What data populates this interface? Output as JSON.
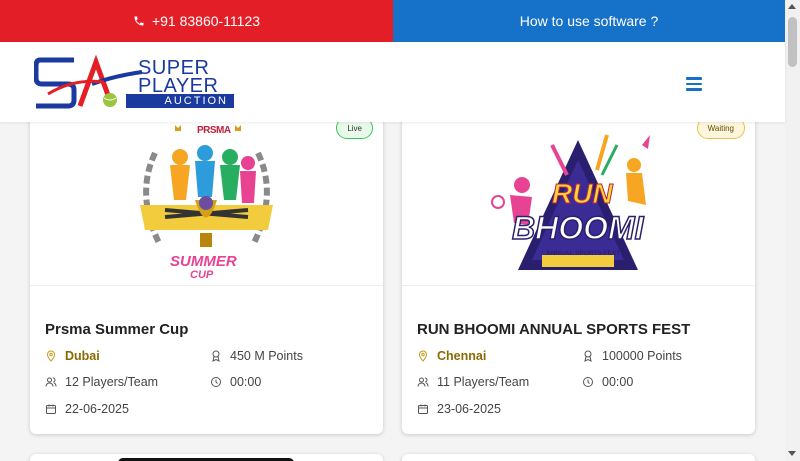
{
  "topbar": {
    "phone": "+91 83860-11123",
    "howto": "How to use software ?"
  },
  "logo": {
    "line1": "SUPER",
    "line2": "PLAYER",
    "line3": "AUCTION"
  },
  "cards": [
    {
      "status": "Live",
      "title": "Prsma Summer Cup",
      "location": "Dubai",
      "points": "450 M Points",
      "players": "12 Players/Team",
      "time": "00:00",
      "date": "22-06-2025",
      "image_label_top": "PRSMA",
      "image_label_bottom": "SUMMER",
      "image_label_cup": "CUP"
    },
    {
      "status": "Waiting",
      "title": "RUN BHOOMI ANNUAL SPORTS FEST",
      "location": "Chennai",
      "points": "100000 Points",
      "players": "11 Players/Team",
      "time": "00:00",
      "date": "23-06-2025",
      "image_label_top": "RUN",
      "image_label_bottom": "BHOOMI",
      "image_label_cup": "ANNUAL SPORTS FEST"
    }
  ],
  "colors": {
    "red": "#e41e26",
    "blue": "#1672c9",
    "brand_navy": "#1a3aa0"
  }
}
